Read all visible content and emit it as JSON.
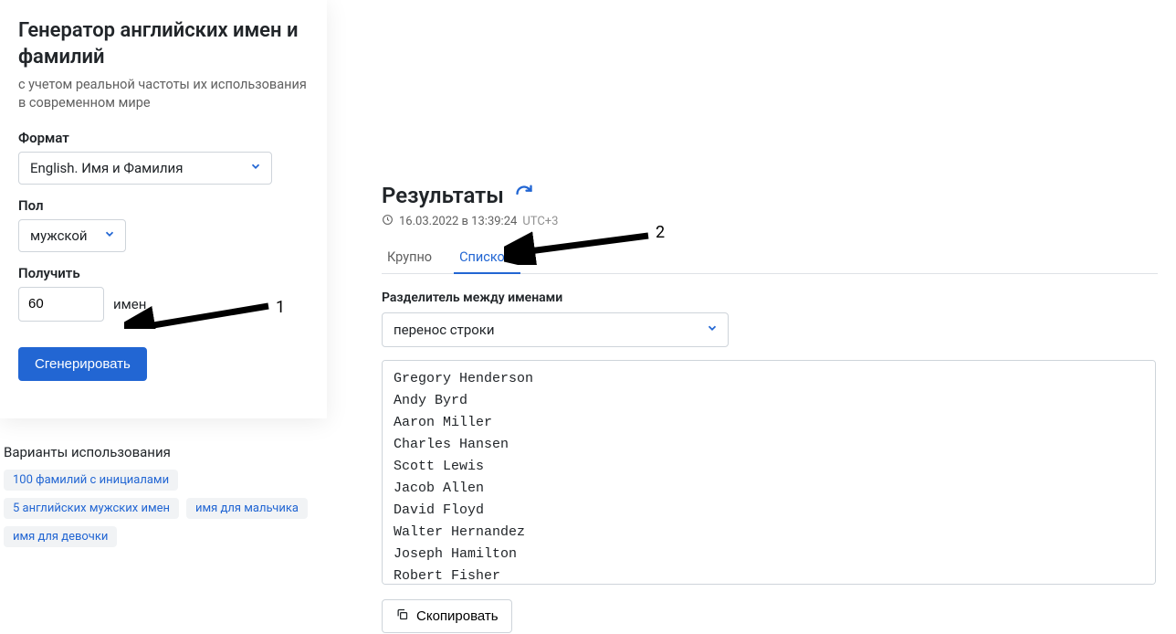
{
  "sidebar": {
    "title": "Генератор английских имен и фамилий",
    "subtitle": "с учетом реальной частоты их использования в современном мире",
    "format_label": "Формат",
    "format_value": "English. Имя и Фамилия",
    "gender_label": "Пол",
    "gender_value": "мужской",
    "count_label": "Получить",
    "count_value": "60",
    "count_unit": "имен",
    "generate_label": "Сгенерировать"
  },
  "usecases": {
    "title": "Варианты использования",
    "tags": [
      "100 фамилий с инициалами",
      "5 английских мужских имен",
      "имя для мальчика",
      "имя для девочки"
    ]
  },
  "results": {
    "title": "Результаты",
    "timestamp": "16.03.2022 в 13:39:24",
    "utc": "UTC+3",
    "tabs": {
      "large": "Крупно",
      "list": "Списком"
    },
    "delim_label": "Разделитель между именами",
    "delim_value": "перенос строки",
    "copy_label": "Скопировать",
    "names": [
      "Gregory Henderson",
      "Andy Byrd",
      "Aaron Miller",
      "Charles Hansen",
      "Scott Lewis",
      "Jacob Allen",
      "David Floyd",
      "Walter Hernandez",
      "Joseph Hamilton",
      "Robert Fisher"
    ]
  },
  "annotations": {
    "one": "1",
    "two": "2"
  }
}
